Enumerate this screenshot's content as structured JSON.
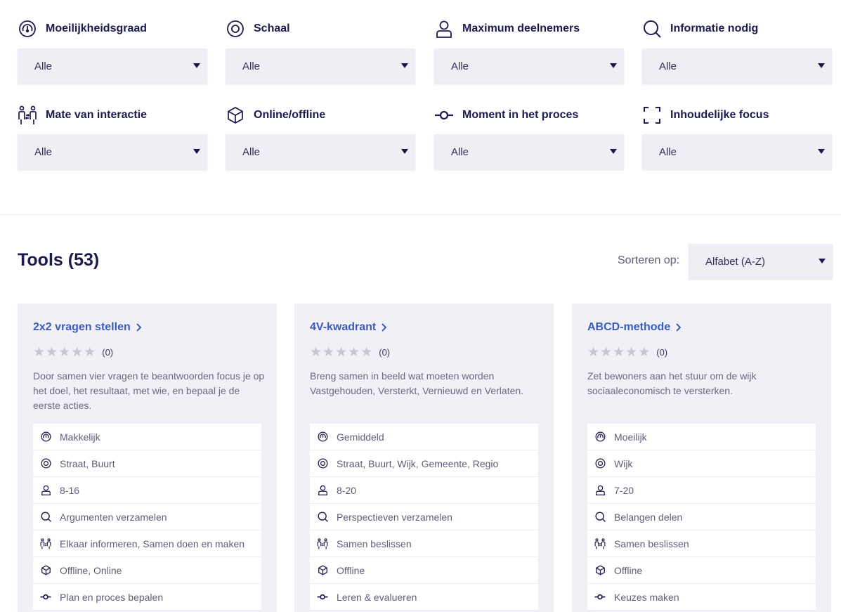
{
  "filters": [
    {
      "label": "Moeilijkheidsgraad",
      "icon": "gauge-icon",
      "value": "Alle"
    },
    {
      "label": "Schaal",
      "icon": "target-icon",
      "value": "Alle"
    },
    {
      "label": "Maximum deelnemers",
      "icon": "person-icon",
      "value": "Alle"
    },
    {
      "label": "Informatie nodig",
      "icon": "search-icon",
      "value": "Alle"
    },
    {
      "label": "Mate van interactie",
      "icon": "people-interaction-icon",
      "value": "Alle"
    },
    {
      "label": "Online/offline",
      "icon": "cube-icon",
      "value": "Alle"
    },
    {
      "label": "Moment in het proces",
      "icon": "timeline-node-icon",
      "value": "Alle"
    },
    {
      "label": "Inhoudelijke focus",
      "icon": "focus-frame-icon",
      "value": "Alle"
    }
  ],
  "tools": {
    "title": "Tools (53)",
    "sort_label": "Sorteren op:",
    "sort_value": "Alfabet (A-Z)"
  },
  "cards": [
    {
      "title": "2x2 vragen stellen",
      "rating_count": "(0)",
      "stars": 0,
      "description": "Door samen vier vragen te beantwoorden focus je op het doel, het resultaat, met wie, en bepaal je de eerste acties.",
      "attributes": [
        "Makkelijk",
        "Straat, Buurt",
        "8-16",
        "Argumenten verzamelen",
        "Elkaar informeren, Samen doen en maken",
        "Offline, Online",
        "Plan en proces bepalen"
      ]
    },
    {
      "title": "4V-kwadrant",
      "rating_count": "(0)",
      "stars": 0,
      "description": "Breng samen in beeld wat moeten worden Vastgehouden, Versterkt, Vernieuwd en Verlaten.",
      "attributes": [
        "Gemiddeld",
        "Straat, Buurt, Wijk, Gemeente, Regio",
        "8-20",
        "Perspectieven verzamelen",
        "Samen beslissen",
        "Offline",
        "Leren & evalueren"
      ]
    },
    {
      "title": "ABCD-methode",
      "rating_count": "(0)",
      "stars": 0,
      "description": "Zet bewoners aan het stuur om de wijk sociaaleconomisch te versterken.",
      "attributes": [
        "Moeilijk",
        "Wijk",
        "7-20",
        "Belangen delen",
        "Samen beslissen",
        "Offline",
        "Keuzes maken"
      ]
    }
  ],
  "colors": {
    "navy": "#1b1a4e",
    "link": "#3c5bbf",
    "card_bg": "#f1f0f6",
    "select_bg": "#efeef5"
  }
}
